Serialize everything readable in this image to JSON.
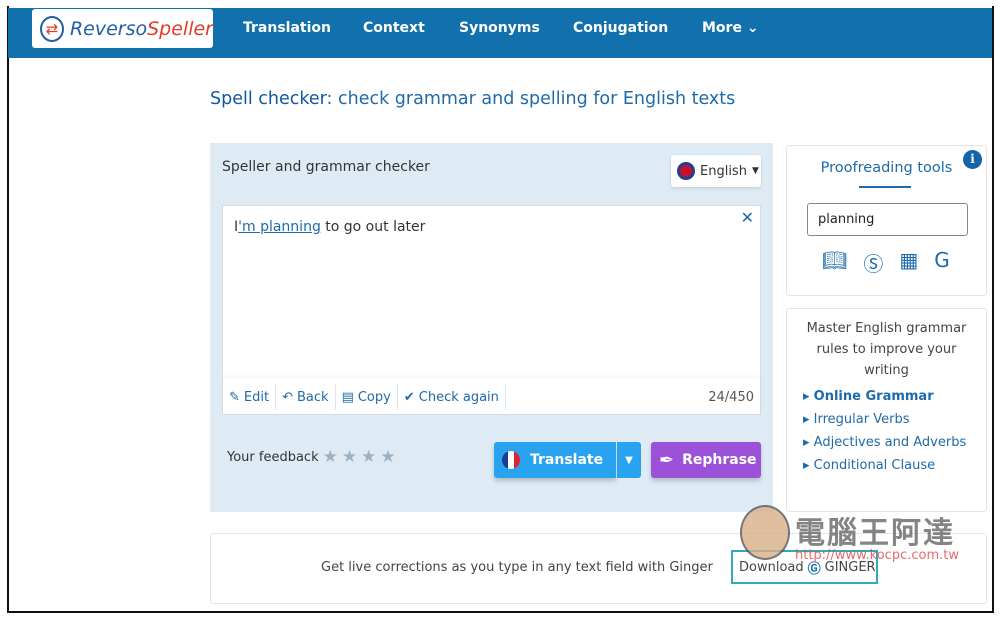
{
  "nav": {
    "logo_reverso": "Reverso",
    "logo_speller": "Speller",
    "items": [
      "Translation",
      "Context",
      "Synonyms",
      "Conjugation",
      "More"
    ]
  },
  "title": {
    "bold": "Spell checker",
    "rest": ": check grammar and spelling for English texts"
  },
  "checker": {
    "heading": "Speller and grammar checker",
    "language": "English",
    "text_prefix": "I",
    "text_link": "'m planning",
    "text_rest": " to go out later",
    "tools": [
      "Edit",
      "Back",
      "Copy",
      "Check again"
    ],
    "count": "24/450",
    "feedback_label": "Your feedback",
    "rating": 0,
    "translate": "Translate",
    "rephrase": "Rephrase"
  },
  "proofreading": {
    "title": "Proofreading tools",
    "search_value": "planning",
    "icons": [
      "dictionary-icon",
      "synonyms-icon",
      "conjugation-table-icon",
      "grammar-check-icon"
    ]
  },
  "grammar": {
    "intro": "Master English grammar rules to improve your writing",
    "links": [
      "Online Grammar",
      "Irregular Verbs",
      "Adjectives and Adverbs",
      "Conditional Clause"
    ]
  },
  "promo": {
    "text": "Get live corrections as you type in any text field with Ginger",
    "download": "Download",
    "brand": "GINGER"
  },
  "watermark": {
    "text": "電腦王阿達",
    "url": "http://www.kocpc.com.tw"
  },
  "colors": {
    "nav": "#1270ad",
    "translate": "#29a3f0",
    "rephrase": "#9b52d9"
  }
}
